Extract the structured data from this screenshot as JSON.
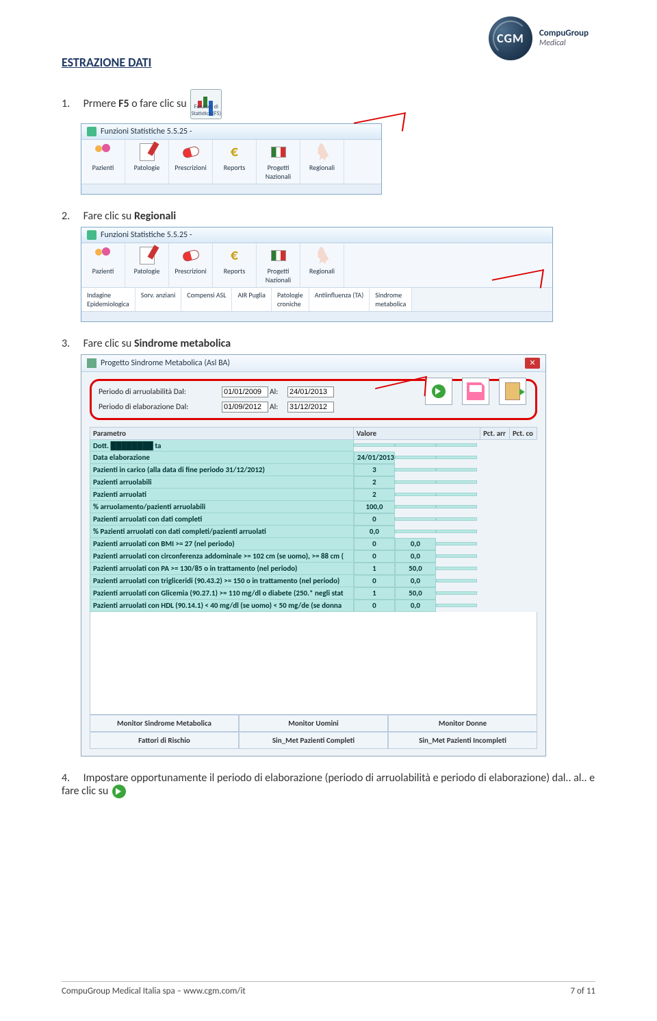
{
  "header": {
    "brand_abbr": "CGM",
    "brand_line1": "CompuGroup",
    "brand_line2": "Medical"
  },
  "section_title": "ESTRAZIONE DATI",
  "steps": {
    "s1_num": "1.",
    "s1_a": "Prmere ",
    "s1_b": "F5",
    "s1_c": " o fare clic su",
    "s2_num": "2.",
    "s2_a": "Fare clic su ",
    "s2_b": "Regionali",
    "s3_num": "3.",
    "s3_a": "Fare clic su ",
    "s3_b": "Sindrome metabolica",
    "s4_num": "4.",
    "s4_a": "Impostare opportunamente il periodo di elaborazione (periodo di arruolabilità e periodo di elaborazione) dal.. al.. e fare clic su"
  },
  "stat_icon_caption": "Funzioni di\nStatistica\n(F5)",
  "win_title": "Funzioni Statistiche 5.5.25  -",
  "toolbar": [
    "Pazienti",
    "Patologie",
    "Prescrizioni",
    "Reports",
    "Progetti\nNazionali",
    "Regionali"
  ],
  "subtabs": [
    "Indagine\nEpidemiologica",
    "Sorv. anziani",
    "Compensi ASL",
    "AIR Puglia",
    "Patologie\ncroniche",
    "Antiinfluenza (TA)",
    "Sindrome\nmetabolica"
  ],
  "dialog": {
    "title": "Progetto Sindrome Metabolica (Asl BA)",
    "lbl_arr": "Periodo di arruolabilità  Dal:",
    "lbl_ela": "Periodo di elaborazione  Dal:",
    "lbl_al": "Al:",
    "date_arr_from": "01/01/2009",
    "date_arr_to": "24/01/2013",
    "date_ela_from": "01/09/2012",
    "date_ela_to": "31/12/2012",
    "cols": [
      "Parametro",
      "Valore",
      "Pct. arr",
      "Pct. co"
    ],
    "rows": [
      [
        "Dott. ████████ ta",
        "",
        "",
        ""
      ],
      [
        "Data elaborazione",
        "24/01/2013",
        "",
        ""
      ],
      [
        "Pazienti in carico (alla data di fine periodo 31/12/2012)",
        "3",
        "",
        ""
      ],
      [
        "Pazienti arruolabili",
        "2",
        "",
        ""
      ],
      [
        "Pazienti arruolati",
        "2",
        "",
        ""
      ],
      [
        "% arruolamento/pazienti arruolabili",
        "100,0",
        "",
        ""
      ],
      [
        "Pazienti arruolati con dati completi",
        "0",
        "",
        ""
      ],
      [
        "% Pazienti arruolati con dati completi/pazienti arruolati",
        "0,0",
        "",
        ""
      ],
      [
        "Pazienti arruolati con BMI >= 27 (nel periodo)",
        "0",
        "0,0",
        ""
      ],
      [
        "Pazienti arruolati con circonferenza addominale >= 102 cm (se uomo), >= 88 cm (",
        "0",
        "0,0",
        ""
      ],
      [
        "Pazienti arruolati con PA >= 130/85 o in trattamento (nel periodo)",
        "1",
        "50,0",
        ""
      ],
      [
        "Pazienti arruolati con trigliceridi (90.43.2) >= 150 o in trattamento (nel periodo)",
        "0",
        "0,0",
        ""
      ],
      [
        "Pazienti arruolati con Glicemia (90.27.1) >= 110 mg/dl o diabete (250.* negli stat",
        "1",
        "50,0",
        ""
      ],
      [
        "Pazienti arruolati con HDL (90.14.1) < 40 mg/dl (se uomo) < 50 mg/de (se donna",
        "0",
        "0,0",
        ""
      ]
    ],
    "bottom_tabs_r1": [
      "Monitor Sindrome Metabolica",
      "Monitor Uomini",
      "Monitor Donne"
    ],
    "bottom_tabs_r2": [
      "Fattori di Rischio",
      "Sin_Met Pazienti Completi",
      "Sin_Met Pazienti Incompleti"
    ]
  },
  "footer": {
    "left": "CompuGroup Medical Italia spa – www.cgm.com/it",
    "right": "7 of 11"
  }
}
